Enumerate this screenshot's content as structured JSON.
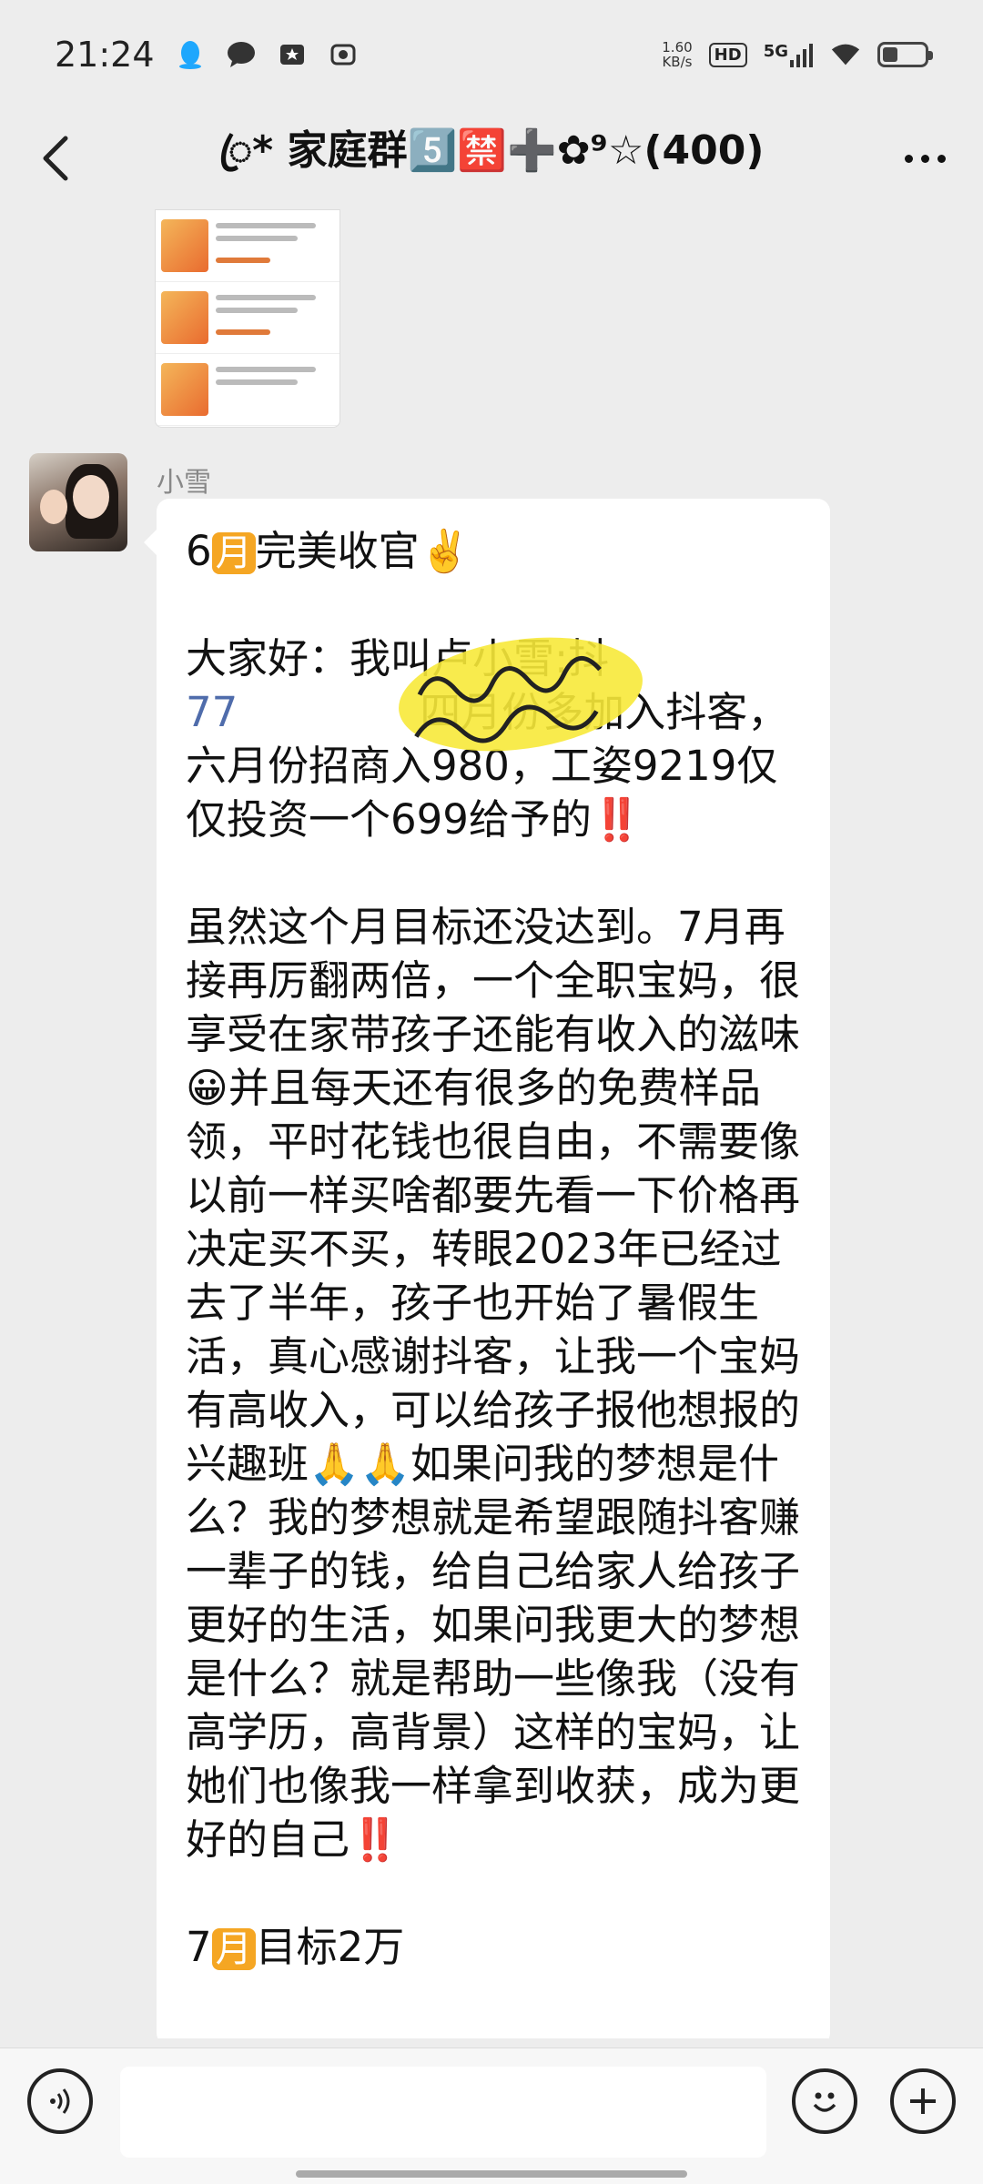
{
  "status_bar": {
    "time": "21:24",
    "net_speed_value": "1.60",
    "net_speed_unit": "KB/s",
    "hd_label": "HD",
    "signal_label": "5G",
    "icons": [
      "qq-icon",
      "chat-bubble-icon",
      "notification-icon",
      "camera-icon",
      "wifi-icon",
      "battery-icon"
    ],
    "battery_level": 0.35
  },
  "nav": {
    "title": "ꦿ* 家庭群5️⃣🈲➕✿⁹☆(400)",
    "back_icon": "chevron-left-icon",
    "more_icon": "more-dots-icon"
  },
  "message": {
    "sender": "小雪",
    "p1_a": "6",
    "p1_month": "月",
    "p1_b": "完美收官✌️",
    "p2_a": "大家好：我叫卢小雪:抖",
    "p2_blue": "77",
    "p2_b": "四月份多加入抖客，六月份招商入980，工姿9219仅仅投资一个699给予的",
    "p2_bang": "‼️",
    "p3_a": "虽然这个月目标还没达到。7月再接再厉翻两倍，一个全职宝妈，很享受在家带孩子还能有收入的滋味😀并且每天还有很多的免费样品领，平时花钱也很自由，不需要像以前一样买啥都要先看一下价格再决定买不买，转眼2023年已经过去了半年，孩子也开始了暑假生活，真心感谢抖客，让我一个宝妈有高收入，可以给孩子报他想报的兴趣班🙏🙏如果问我的梦想是什么？我的梦想就是希望跟随抖客赚一辈子的钱，给自己给家人给孩子更好的生活，如果问我更大的梦想是什么？就是帮助一些像我（没有高学历，高背景）这样的宝妈，让她们也像我一样拿到收获，成为更好的自己",
    "p3_bang": "‼️",
    "p4_a": "7",
    "p4_month": "月",
    "p4_b": "目标2万"
  },
  "input_bar": {
    "voice_icon": "voice-icon",
    "emoji_icon": "emoji-icon",
    "plus_icon": "plus-icon",
    "placeholder": ""
  },
  "colors": {
    "accent_orange": "#f5a623",
    "link_blue": "#4f6cab",
    "alert_red": "#e02020",
    "highlight_yellow": "#f7e93a"
  }
}
